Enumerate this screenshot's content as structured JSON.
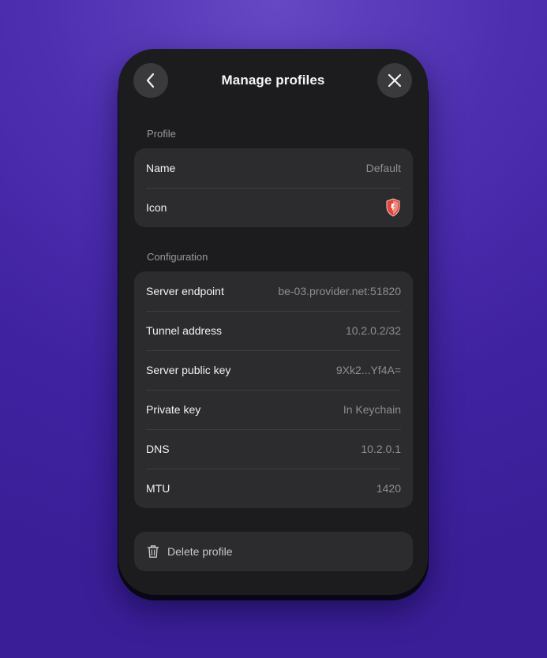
{
  "header": {
    "title": "Manage profiles",
    "back_icon": "chevron-left-icon",
    "close_icon": "close-icon"
  },
  "profile_section": {
    "label": "Profile",
    "rows": [
      {
        "label": "Name",
        "value": "Default"
      },
      {
        "label": "Icon",
        "icon": "shield-icon"
      }
    ]
  },
  "configuration_section": {
    "label": "Configuration",
    "rows": [
      {
        "label": "Server endpoint",
        "value": "be-03.provider.net:51820"
      },
      {
        "label": "Tunnel address",
        "value": "10.2.0.2/32"
      },
      {
        "label": "Server public key",
        "value": "9Xk2...Yf4A="
      },
      {
        "label": "Private key",
        "value": "In Keychain"
      },
      {
        "label": "DNS",
        "value": "10.2.0.1"
      },
      {
        "label": "MTU",
        "value": "1420"
      }
    ]
  },
  "delete": {
    "label": "Delete profile",
    "icon": "trash-icon"
  },
  "colors": {
    "background": "#4e2fb0",
    "panel": "#1c1c1e",
    "card": "#2c2c2e",
    "shield_red": "#e0443a"
  }
}
